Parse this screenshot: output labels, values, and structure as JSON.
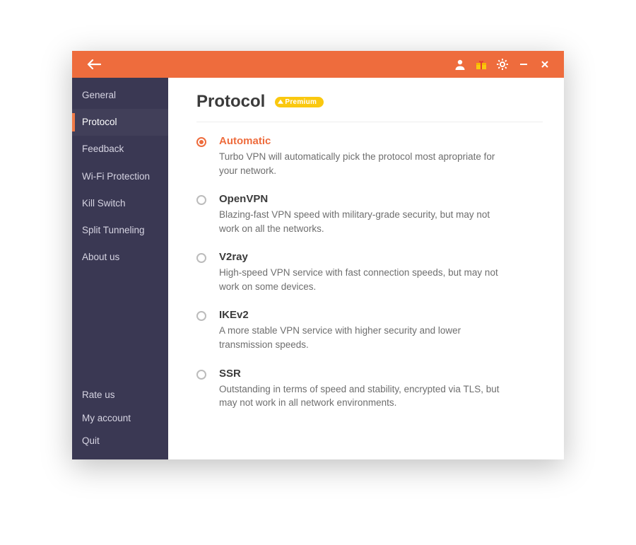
{
  "accent": "#EE6C3D",
  "sidebar_bg": "#3A3853",
  "header": {
    "icons": {
      "back": "back-arrow",
      "user": "user-icon",
      "gift": "gift-icon",
      "settings": "gear-icon",
      "minimize": "minimize-icon",
      "close": "close-icon"
    }
  },
  "sidebar": {
    "items": [
      {
        "id": "general",
        "label": "General",
        "active": false
      },
      {
        "id": "protocol",
        "label": "Protocol",
        "active": true
      },
      {
        "id": "feedback",
        "label": "Feedback",
        "active": false
      },
      {
        "id": "wifi-protection",
        "label": "Wi-Fi Protection",
        "active": false
      },
      {
        "id": "kill-switch",
        "label": "Kill Switch",
        "active": false
      },
      {
        "id": "split-tunneling",
        "label": "Split Tunneling",
        "active": false
      },
      {
        "id": "about-us",
        "label": "About us",
        "active": false
      }
    ],
    "bottom_items": [
      {
        "id": "rate-us",
        "label": "Rate us"
      },
      {
        "id": "my-account",
        "label": "My account"
      },
      {
        "id": "quit",
        "label": "Quit"
      }
    ]
  },
  "page": {
    "title": "Protocol",
    "badge": "Premium"
  },
  "options": [
    {
      "id": "automatic",
      "label": "Automatic",
      "desc": "Turbo VPN will automatically pick the protocol most apropriate for your network.",
      "selected": true
    },
    {
      "id": "openvpn",
      "label": "OpenVPN",
      "desc": "Blazing-fast VPN speed with military-grade security, but may not work on all the networks.",
      "selected": false
    },
    {
      "id": "v2ray",
      "label": "V2ray",
      "desc": "High-speed VPN service with fast connection speeds, but may not work on some devices.",
      "selected": false
    },
    {
      "id": "ikev2",
      "label": "IKEv2",
      "desc": "A more stable VPN service with higher security and lower transmission speeds.",
      "selected": false
    },
    {
      "id": "ssr",
      "label": "SSR",
      "desc": "Outstanding in terms of speed and stability, encrypted via TLS, but may not work in all network environments.",
      "selected": false
    }
  ]
}
